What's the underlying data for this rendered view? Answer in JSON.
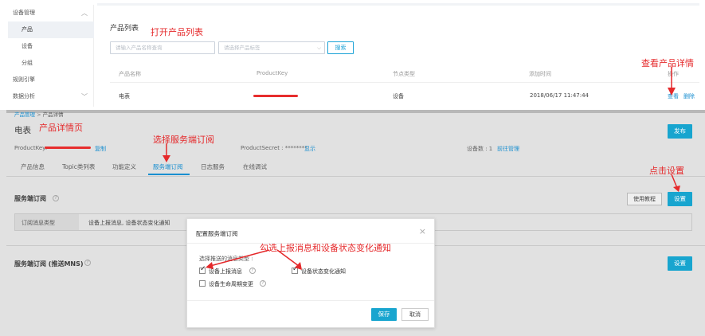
{
  "sidebar": {
    "section": "设备管理",
    "items": [
      {
        "label": "产品"
      },
      {
        "label": "设备"
      },
      {
        "label": "分组"
      }
    ],
    "rules": "规则引擎",
    "analytics": "数据分析"
  },
  "product_list": {
    "title": "产品列表",
    "search_placeholder": "请输入产品名称查询",
    "select_placeholder": "请选择产品标签",
    "search_button": "搜索",
    "columns": [
      "产品名称",
      "ProductKey",
      "节点类型",
      "添加时间",
      "操作"
    ],
    "rows": [
      {
        "name": "电表",
        "node_type": "设备",
        "added": "2018/06/17 11:47:44",
        "action_view": "查看",
        "action_delete": "删除"
      }
    ]
  },
  "annotations": {
    "open_list": "打开产品列表",
    "view_detail": "查看产品详情",
    "detail_page": "产品详情页",
    "choose_sub": "选择服务端订阅",
    "click_setting": "点击设置",
    "check_msgs": "勾选上报消息和设备状态变化通知"
  },
  "detail": {
    "breadcrumb": [
      "产品管理",
      "产品详情"
    ],
    "breadcrumb_sep": ">",
    "title": "电表",
    "publish_button": "发布",
    "product_key_label": "ProductKey:",
    "copy_label": "复制",
    "secret_label": "ProductSecret : ********",
    "secret_show": "显示",
    "device_count_label": "设备数 : 1",
    "device_manage": "前往管理",
    "tabs": [
      "产品信息",
      "Topic类列表",
      "功能定义",
      "服务端订阅",
      "日志服务",
      "在线调试"
    ],
    "active_tab": "服务端订阅"
  },
  "subscription": {
    "title": "服务端订阅",
    "help_button": "使用教程",
    "setting_button": "设置",
    "type_label": "订阅消息类型",
    "type_value": "设备上报消息, 设备状态变化通知",
    "mns_title": "服务端订阅 (推送MNS)",
    "mns_setting_button": "设置"
  },
  "modal": {
    "title": "配置服务端订阅",
    "close": "×",
    "prompt": "选择推送的消息类型 :",
    "options": [
      {
        "label": "设备上报消息",
        "checked": true
      },
      {
        "label": "设备状态变化通知",
        "checked": true
      },
      {
        "label": "设备生命周期变更",
        "checked": false
      }
    ],
    "save_button": "保存",
    "cancel_button": "取消"
  },
  "colors": {
    "accent": "#18a5cf",
    "link": "#1a8fd0",
    "annotation": "#e5292b"
  }
}
